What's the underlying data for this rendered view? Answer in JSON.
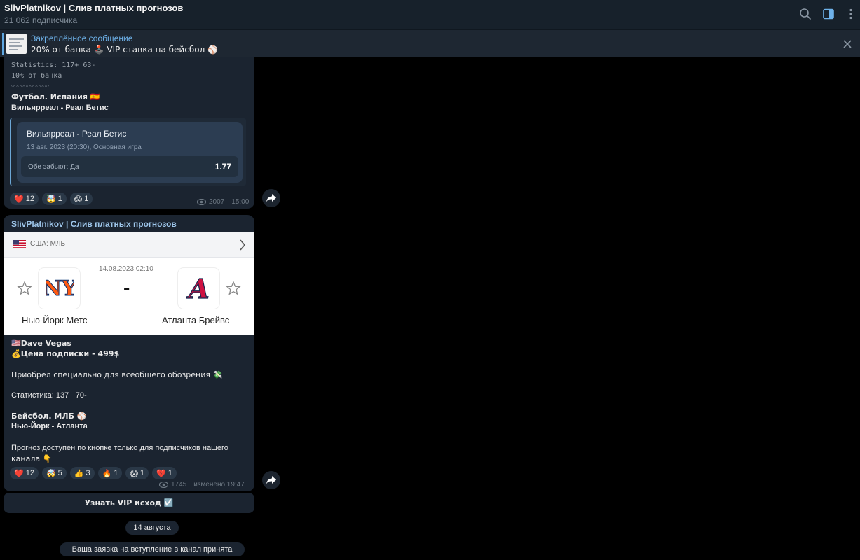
{
  "header": {
    "title": "SlivPlatnikov | Слив платных прогнозов",
    "subtitle": "21 062 подписчика"
  },
  "pinned": {
    "title": "Закреплённое сообщение",
    "text": "20% от банка 🕹️  VIP ставка на бейсбол ⚾"
  },
  "message1": {
    "stats_line1": "Statistics: 117+ 63-",
    "stats_line2": "10% от банка",
    "squiggle": "〰〰〰〰〰〰",
    "sport_line": "Футбол. Испания 🇪🇸",
    "match_line": "Вильярреал - Реал Бетис",
    "card": {
      "title": "Вильярреал - Реал Бетис",
      "subtitle": "13 авг. 2023 (20:30), Основная игра",
      "odds_label": "Обе забьют: Да",
      "odds_value": "1.77"
    },
    "reactions": [
      {
        "emoji": "❤️",
        "count": "12"
      },
      {
        "emoji": "🤯",
        "count": "1"
      },
      {
        "emoji": "😱",
        "count": "1"
      }
    ],
    "views": "2007",
    "time": "15:00"
  },
  "message2": {
    "sender": "SlivPlatnikov | Слив платных прогнозов",
    "match_image": {
      "league": "США: МЛБ",
      "datetime": "14.08.2023 02:10",
      "score": "-",
      "home_team": "Нью-Йорк Метс",
      "away_team": "Атланта Брейвс"
    },
    "lines": [
      "🇺🇸Dave Vegas",
      "💰Цена подписки - 499$",
      "Приобрел специально для всеобщего обозрения 💸",
      "Статистика: 137+ 70-",
      "Бейсбол. МЛБ ⚾",
      "Нью-Йорк - Атланта",
      "Прогноз доступен по кнопке только для подписчиков нашего",
      "канала 👇"
    ],
    "reactions": [
      {
        "emoji": "❤️",
        "count": "12"
      },
      {
        "emoji": "🤯",
        "count": "5"
      },
      {
        "emoji": "👍",
        "count": "3"
      },
      {
        "emoji": "🔥",
        "count": "1"
      },
      {
        "emoji": "😱",
        "count": "1"
      },
      {
        "emoji": "💔",
        "count": "1"
      }
    ],
    "views": "1745",
    "time": "изменено 19:47"
  },
  "vip_button": "Узнать VIP исход ☑️",
  "date_pill": "14 августа",
  "service_msg": "Ваша заявка на вступление в канал принята",
  "colors": {
    "accent": "#6eb2ea",
    "bubble": "#1b2430",
    "header": "#17212b"
  }
}
